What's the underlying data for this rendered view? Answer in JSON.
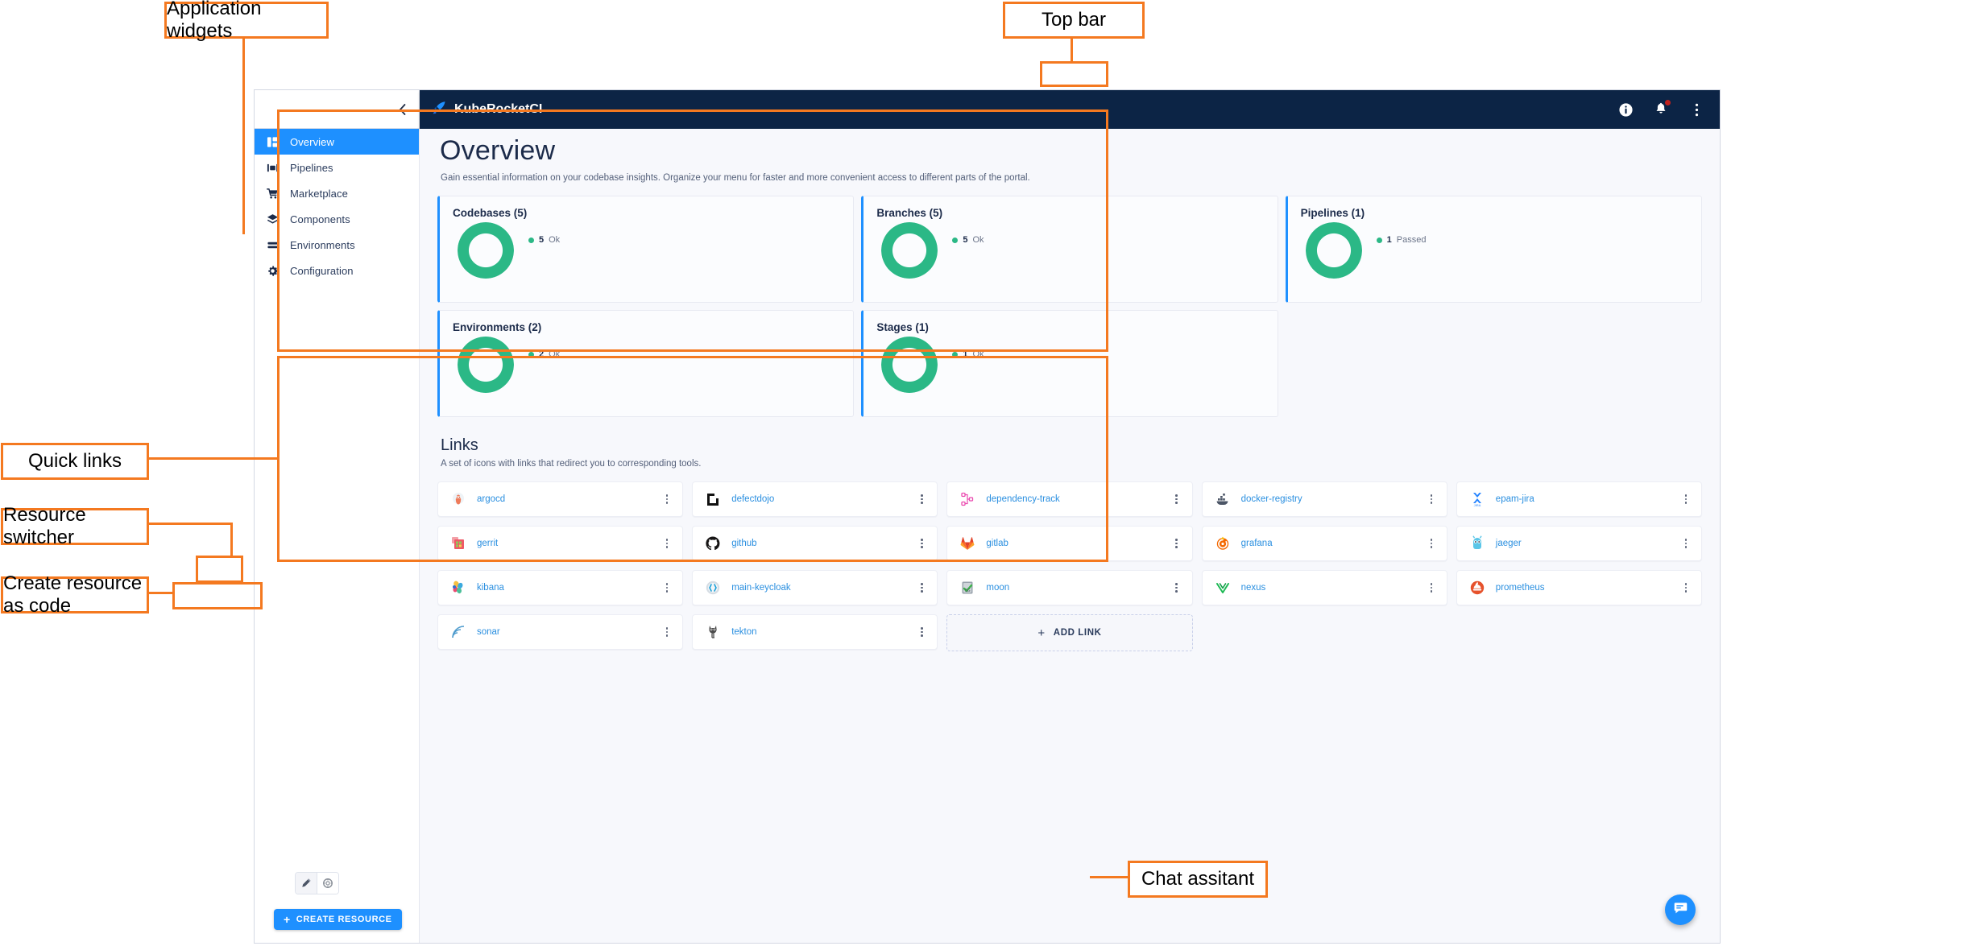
{
  "annotations": [
    {
      "id": "application-widgets",
      "label": "Application widgets"
    },
    {
      "id": "top-bar",
      "label": "Top bar"
    },
    {
      "id": "quick-links",
      "label": "Quick links"
    },
    {
      "id": "resource-switcher",
      "label": "Resource switcher"
    },
    {
      "id": "create-resource-as-code",
      "label": "Create resource as code"
    },
    {
      "id": "chat-assistant",
      "label": "Chat assitant"
    }
  ],
  "topbar": {
    "brand": "KubeRocketCI",
    "logo_icon": "rocket-icon",
    "actions": [
      {
        "name": "info-icon",
        "label": "i"
      },
      {
        "name": "notifications-bell-icon",
        "label": "",
        "badge": true
      },
      {
        "name": "more-vertical-icon",
        "label": ""
      }
    ]
  },
  "sidebar": {
    "collapse_icon": "chevron-left-icon",
    "items": [
      {
        "label": "Overview",
        "icon": "dashboard-icon",
        "active": true
      },
      {
        "label": "Pipelines",
        "icon": "pipelines-icon",
        "active": false
      },
      {
        "label": "Marketplace",
        "icon": "cart-icon",
        "active": false
      },
      {
        "label": "Components",
        "icon": "layers-icon",
        "active": false
      },
      {
        "label": "Environments",
        "icon": "stack-icon",
        "active": false
      },
      {
        "label": "Configuration",
        "icon": "gear-icon",
        "active": false
      }
    ],
    "resource_switcher": [
      {
        "name": "form-editor-icon",
        "label": "pen"
      },
      {
        "name": "code-editor-icon",
        "label": "yaml"
      }
    ],
    "create_button": {
      "label": "CREATE RESOURCE",
      "icon": "plus-icon"
    }
  },
  "page": {
    "title": "Overview",
    "description": "Gain essential information on your codebase insights. Organize your menu for faster and more convenient access to different parts of the portal."
  },
  "widgets": [
    {
      "title": "Codebases (5)",
      "count": 5,
      "status": "Ok",
      "color": "#2bb886",
      "percent": 100
    },
    {
      "title": "Branches (5)",
      "count": 5,
      "status": "Ok",
      "color": "#2bb886",
      "percent": 100
    },
    {
      "title": "Pipelines (1)",
      "count": 1,
      "status": "Passed",
      "color": "#2bb886",
      "percent": 100
    },
    {
      "title": "Environments (2)",
      "count": 2,
      "status": "Ok",
      "color": "#2bb886",
      "percent": 100
    },
    {
      "title": "Stages (1)",
      "count": 1,
      "status": "Ok",
      "color": "#2bb886",
      "percent": 100
    }
  ],
  "links": {
    "title": "Links",
    "description": "A set of icons with links that redirect you to corresponding tools.",
    "items": [
      {
        "name": "argocd",
        "icon": "argocd-icon"
      },
      {
        "name": "defectdojo",
        "icon": "defectdojo-icon"
      },
      {
        "name": "dependency-track",
        "icon": "dependency-track-icon"
      },
      {
        "name": "docker-registry",
        "icon": "docker-registry-icon"
      },
      {
        "name": "epam-jira",
        "icon": "jira-icon"
      },
      {
        "name": "gerrit",
        "icon": "gerrit-icon"
      },
      {
        "name": "github",
        "icon": "github-icon"
      },
      {
        "name": "gitlab",
        "icon": "gitlab-icon"
      },
      {
        "name": "grafana",
        "icon": "grafana-icon"
      },
      {
        "name": "jaeger",
        "icon": "jaeger-icon"
      },
      {
        "name": "kibana",
        "icon": "kibana-icon"
      },
      {
        "name": "main-keycloak",
        "icon": "keycloak-icon"
      },
      {
        "name": "moon",
        "icon": "moon-icon"
      },
      {
        "name": "nexus",
        "icon": "nexus-icon"
      },
      {
        "name": "prometheus",
        "icon": "prometheus-icon"
      },
      {
        "name": "sonar",
        "icon": "sonarqube-icon"
      },
      {
        "name": "tekton",
        "icon": "tekton-icon"
      }
    ],
    "add_link": {
      "label": "ADD LINK",
      "icon": "plus-icon"
    }
  },
  "chat": {
    "icon": "chat-bubble-icon"
  },
  "colors": {
    "accent_blue": "#1e90ff",
    "navy": "#0c2445",
    "green": "#2bb886",
    "annotation_orange": "#f47920",
    "link_blue": "#2a8fe0"
  }
}
